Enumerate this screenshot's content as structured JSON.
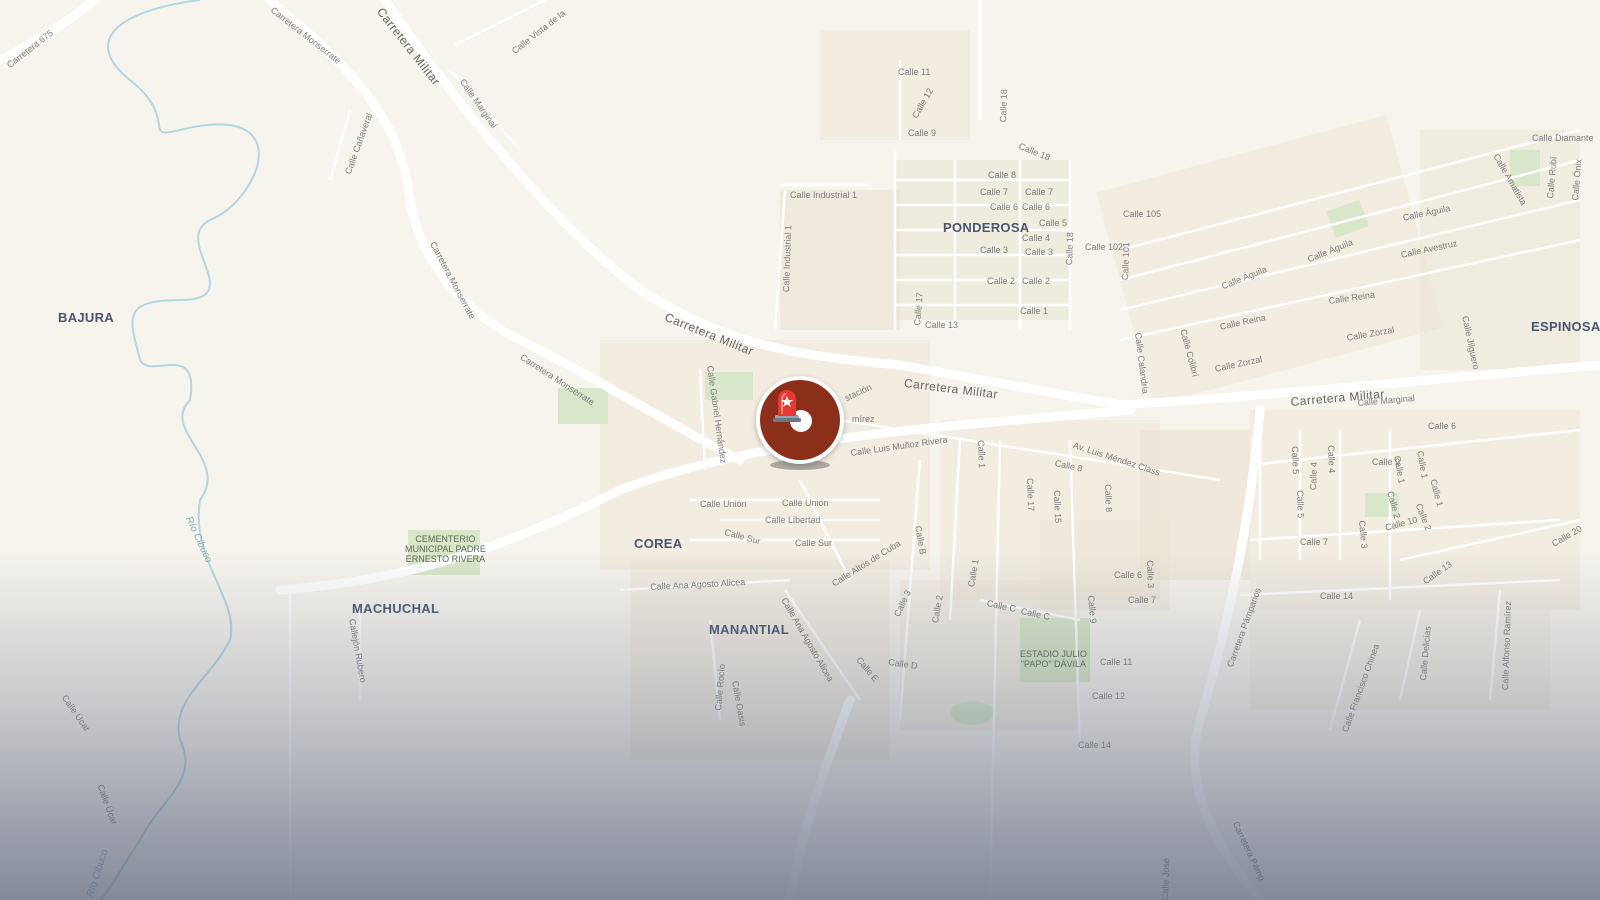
{
  "map": {
    "neighborhoods": [
      "BAJURA",
      "PONDEROSA",
      "ESPINOSA",
      "COREA",
      "MACHUCHAL",
      "MANANTIAL"
    ],
    "major_roads": [
      "Carretera Militar",
      "Carretera Militar",
      "Carretera Militar",
      "Carretera Militar",
      "Carretera Monserrate",
      "Carretera Monserrate",
      "Carretera Monserrate",
      "Carretera 675",
      "Carretera Pámpanos",
      "Carretera Pámp"
    ],
    "streets": [
      "Calle Vista de la",
      "Calle Marginal",
      "Calle Cañaveral",
      "Calle 11",
      "Calle 12",
      "Calle 9",
      "Calle 18",
      "Calle 18",
      "Calle Industrial 1",
      "Calle Industrial 1",
      "Calle 8",
      "Calle 7",
      "Calle 7",
      "Calle 6",
      "Calle 6",
      "Calle 5",
      "Calle 4",
      "Calle 3",
      "Calle 3",
      "Calle 2",
      "Calle 2",
      "Calle 1",
      "Calle 13",
      "Calle 17",
      "Calle 18",
      "Calle 105",
      "Calle 102",
      "Calle 101",
      "Calle Diamante",
      "Calle Amatista",
      "Calle Rubí",
      "Calle Ónix",
      "Calle Águila",
      "Calle Águila",
      "Calle Águila",
      "Calle Avestruz",
      "Calle Reina",
      "Calle Reina",
      "Calle Zorzal",
      "Calle Zorzal",
      "Calle Jilguero",
      "Calle Colibrí",
      "Calle Calandria",
      "Calle Marginal",
      "Calle 6",
      "Calle 9",
      "Calle 1",
      "Calle 4",
      "Calle 5",
      "Calle 5",
      "Calle 1",
      "Calle 2",
      "Calle 3",
      "Calle 10",
      "Calle 7",
      "Calle 14",
      "Calle 13",
      "Calle 20",
      "Calle Gabriel Hernández",
      "stación",
      "mírez",
      "Calle Luis Muñoz Rivera",
      "Av. Luis Méndez Class",
      "Calle 8",
      "Calle 1",
      "Calle 17",
      "Calle 15",
      "Calle 8",
      "Calle Unión",
      "Calle Unión",
      "Calle Libertad",
      "Calle Sur",
      "Calle Sur",
      "Calle B",
      "Calle Altos de Cuba",
      "Calle Ana Agosto Alicea",
      "Calle Ana Agosto Alicea",
      "Calle 1",
      "Calle 2",
      "Calle 3",
      "Calle C",
      "Calle C",
      "Calle 6",
      "Calle 3",
      "Calle 7",
      "Calle 9",
      "Calle 11",
      "Calle 12",
      "Calle 14",
      "Calle D",
      "Calle E",
      "Calle Rocío",
      "Calle Oasis",
      "Callejón Rubero",
      "Calle Úcar",
      "Calle Úcar",
      "Calle Francisco Chinea",
      "Calle Delicias",
      "Calle Alfonso Ramírez",
      "Calle 4",
      "Calle 2",
      "Calle 1",
      "Calle José"
    ],
    "pois": [
      "CEMENTERIO\nMUNICIPAL PADRE\nERNESTO RIVERA",
      "ESTADIO JULIO\n\"PAPO\" DÁVILA"
    ],
    "water": [
      "Río Cibuco",
      "Río Cibuco"
    ]
  },
  "marker": {
    "icon": "siren-icon",
    "color": "#8b2e1a"
  },
  "colors": {
    "land": "#f7f4ed",
    "road": "#ffffff",
    "building": "#ebe3d3",
    "park": "#d8e7c9",
    "river": "#b3d6e5"
  }
}
